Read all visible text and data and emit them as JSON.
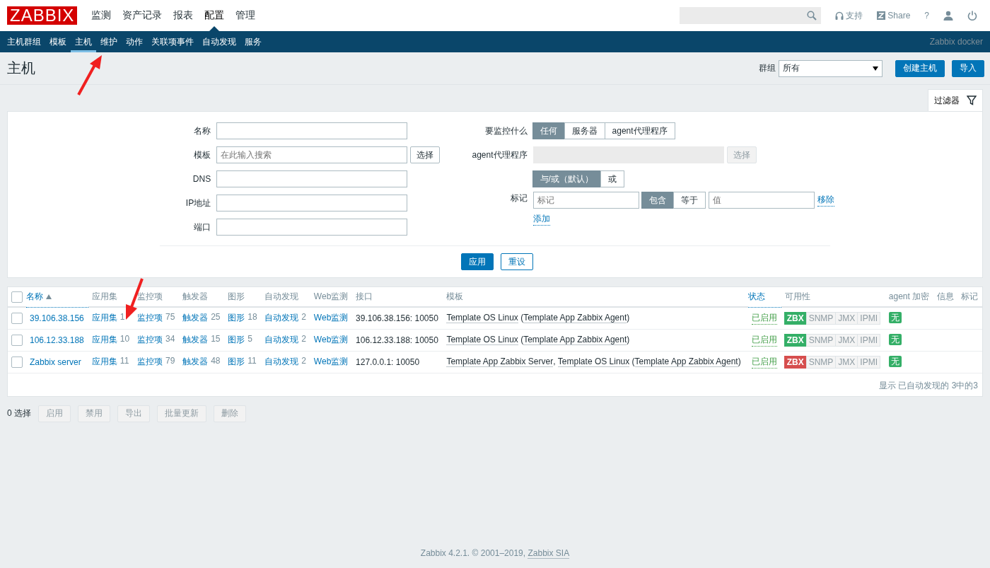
{
  "logo": "ZABBIX",
  "top_nav": [
    {
      "label": "监测",
      "selected": false
    },
    {
      "label": "资产记录",
      "selected": false
    },
    {
      "label": "报表",
      "selected": false
    },
    {
      "label": "配置",
      "selected": true
    },
    {
      "label": "管理",
      "selected": false
    }
  ],
  "header_links": [
    {
      "kind": "support",
      "label": "支持"
    },
    {
      "kind": "share",
      "label": "Share"
    },
    {
      "kind": "help",
      "label": "?"
    },
    {
      "kind": "user"
    },
    {
      "kind": "logout"
    }
  ],
  "sub_nav": [
    {
      "label": "主机群组",
      "selected": false
    },
    {
      "label": "模板",
      "selected": false
    },
    {
      "label": "主机",
      "selected": true
    },
    {
      "label": "维护",
      "selected": false
    },
    {
      "label": "动作",
      "selected": false
    },
    {
      "label": "关联项事件",
      "selected": false
    },
    {
      "label": "自动发现",
      "selected": false
    },
    {
      "label": "服务",
      "selected": false
    }
  ],
  "server_name": "Zabbix docker",
  "page_title": "主机",
  "group_filter": {
    "label": "群组",
    "value": "所有"
  },
  "header_buttons": [
    "创建主机",
    "导入"
  ],
  "filter_tab": "过滤器",
  "filter_left": [
    {
      "label": "名称"
    },
    {
      "label": "模板",
      "placeholder": "在此输入搜索",
      "button": "选择"
    },
    {
      "label": "DNS"
    },
    {
      "label": "IP地址"
    },
    {
      "label": "端口"
    }
  ],
  "monitored_by": {
    "label": "要监控什么",
    "options": [
      {
        "label": "任何",
        "selected": true
      },
      {
        "label": "服务器",
        "selected": false
      },
      {
        "label": "agent代理程序",
        "selected": false
      }
    ]
  },
  "proxy": {
    "label": "agent代理程序",
    "button": "选择",
    "disabled": true
  },
  "tags": {
    "label": "标记",
    "operators": [
      {
        "label": "与/或（默认）",
        "selected": true
      },
      {
        "label": "或",
        "selected": false
      }
    ],
    "row": {
      "tag_placeholder": "标记",
      "conditions": [
        {
          "label": "包含",
          "selected": true
        },
        {
          "label": "等于",
          "selected": false
        }
      ],
      "value_placeholder": "值",
      "remove": "移除"
    },
    "add": "添加"
  },
  "filter_buttons": [
    "应用",
    "重设"
  ],
  "table": {
    "select_all_checked": false,
    "columns": [
      {
        "label": "名称",
        "sorted": true,
        "link": true
      },
      {
        "label": "应用集"
      },
      {
        "label": "监控项"
      },
      {
        "label": "触发器"
      },
      {
        "label": "图形"
      },
      {
        "label": "自动发现"
      },
      {
        "label": "Web监测"
      },
      {
        "label": "接口"
      },
      {
        "label": "模板"
      },
      {
        "label": "状态",
        "link": true
      },
      {
        "label": "可用性"
      },
      {
        "label": "agent 加密"
      },
      {
        "label": "信息"
      },
      {
        "label": "标记"
      }
    ],
    "rows": [
      {
        "checked": false,
        "name": "39.106.38.156",
        "counts": [
          {
            "label": "应用集",
            "count": "1"
          },
          {
            "label": "监控项",
            "count": "75"
          },
          {
            "label": "触发器",
            "count": "25"
          },
          {
            "label": "图形",
            "count": "18"
          },
          {
            "label": "自动发现",
            "count": "2"
          },
          {
            "label": "Web监测"
          }
        ],
        "interface": "39.106.38.156: 10050",
        "templates": [
          {
            "kind": "link",
            "text": "Template OS Linux"
          },
          {
            "kind": "plain",
            "text": " ("
          },
          {
            "kind": "link",
            "text": "Template App Zabbix Agent"
          },
          {
            "kind": "plain",
            "text": ")"
          }
        ],
        "status": "已启用",
        "availability": [
          {
            "label": "ZBX",
            "color": "#34af67"
          },
          {
            "label": "SNMP"
          },
          {
            "label": "JMX"
          },
          {
            "label": "IPMI"
          }
        ],
        "encryption": "无"
      },
      {
        "checked": false,
        "name": "106.12.33.188",
        "counts": [
          {
            "label": "应用集",
            "count": "10"
          },
          {
            "label": "监控项",
            "count": "34"
          },
          {
            "label": "触发器",
            "count": "15"
          },
          {
            "label": "图形",
            "count": "5"
          },
          {
            "label": "自动发现",
            "count": "2"
          },
          {
            "label": "Web监测"
          }
        ],
        "interface": "106.12.33.188: 10050",
        "templates": [
          {
            "kind": "link",
            "text": "Template OS Linux"
          },
          {
            "kind": "plain",
            "text": " ("
          },
          {
            "kind": "link",
            "text": "Template App Zabbix Agent"
          },
          {
            "kind": "plain",
            "text": ")"
          }
        ],
        "status": "已启用",
        "availability": [
          {
            "label": "ZBX",
            "color": "#34af67"
          },
          {
            "label": "SNMP"
          },
          {
            "label": "JMX"
          },
          {
            "label": "IPMI"
          }
        ],
        "encryption": "无"
      },
      {
        "checked": false,
        "name": "Zabbix server",
        "counts": [
          {
            "label": "应用集",
            "count": "11"
          },
          {
            "label": "监控项",
            "count": "79"
          },
          {
            "label": "触发器",
            "count": "48"
          },
          {
            "label": "图形",
            "count": "11"
          },
          {
            "label": "自动发现",
            "count": "2"
          },
          {
            "label": "Web监测"
          }
        ],
        "interface": "127.0.0.1: 10050",
        "templates": [
          {
            "kind": "link",
            "text": "Template App Zabbix Server"
          },
          {
            "kind": "plain",
            "text": ", "
          },
          {
            "kind": "link",
            "text": "Template OS Linux"
          },
          {
            "kind": "plain",
            "text": " ("
          },
          {
            "kind": "link",
            "text": "Template App Zabbix Agent"
          },
          {
            "kind": "plain",
            "text": ")"
          }
        ],
        "status": "已启用",
        "availability": [
          {
            "label": "ZBX",
            "color": "#d64e4e"
          },
          {
            "label": "SNMP"
          },
          {
            "label": "JMX"
          },
          {
            "label": "IPMI"
          }
        ],
        "encryption": "无"
      }
    ],
    "summary": "显示 已自动发现的 3中的3"
  },
  "selected_count": "0 选择",
  "mass_actions": [
    {
      "label": "启用",
      "disabled": true
    },
    {
      "label": "禁用",
      "disabled": true
    },
    {
      "label": "导出",
      "disabled": true
    },
    {
      "label": "批量更新",
      "disabled": true
    },
    {
      "label": "删除",
      "disabled": true
    }
  ],
  "footer": [
    {
      "kind": "plain",
      "text": "Zabbix 4.2.1. © 2001–2019, "
    },
    {
      "kind": "link",
      "text": "Zabbix SIA"
    }
  ]
}
